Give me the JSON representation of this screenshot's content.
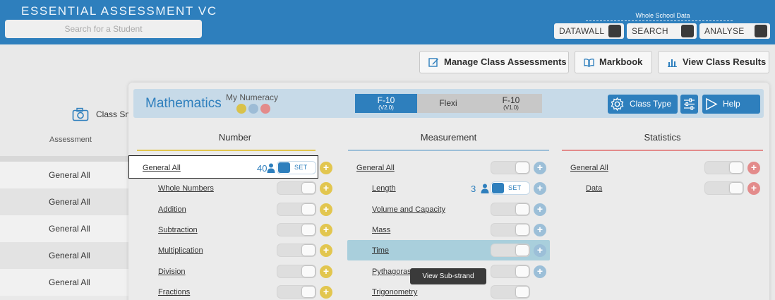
{
  "app": {
    "title": "ESSENTIAL ASSESSMENT VC"
  },
  "search": {
    "placeholder": "Search for a Student"
  },
  "whole_school": {
    "label": "Whole School Data",
    "buttons": [
      "DATAWALL",
      "SEARCH",
      "ANALYSE"
    ]
  },
  "actions": {
    "manage": "Manage Class Assessments",
    "markbook": "Markbook",
    "results": "View Class Results"
  },
  "background": {
    "class_label": "Class Sn",
    "assessment_header": "Assessment",
    "rows": [
      "General All",
      "General All",
      "General All",
      "General All",
      "General All"
    ]
  },
  "panel": {
    "subject": "Mathematics",
    "my_numeracy": "My Numeracy",
    "dot_colors": [
      "#d9c24a",
      "#9dbcd6",
      "#e38b8b"
    ],
    "curriculum_tabs": [
      {
        "main": "F-10",
        "sub": "(V2.0)",
        "active": true
      },
      {
        "main": "Flexi",
        "sub": "",
        "active": false
      },
      {
        "main": "F-10",
        "sub": "(V1.0)",
        "active": false
      }
    ],
    "class_type": "Class Type",
    "help": "Help",
    "set_label": "SET",
    "tooltip": "View Sub-strand",
    "columns": [
      {
        "title": "Number",
        "accent": "#e2c64f",
        "items": [
          {
            "label": "General All",
            "indent": false,
            "set": true,
            "count": "40"
          },
          {
            "label": "Whole Numbers",
            "indent": true,
            "set": false
          },
          {
            "label": "Addition",
            "indent": true,
            "set": false
          },
          {
            "label": "Subtraction",
            "indent": true,
            "set": false
          },
          {
            "label": "Multiplication",
            "indent": true,
            "set": false
          },
          {
            "label": "Division",
            "indent": true,
            "set": false
          },
          {
            "label": "Fractions",
            "indent": true,
            "set": false
          }
        ]
      },
      {
        "title": "Measurement",
        "accent": "#9cbfd8",
        "items": [
          {
            "label": "General All",
            "indent": false,
            "set": false
          },
          {
            "label": "Length",
            "indent": true,
            "set": true,
            "count": "3"
          },
          {
            "label": "Volume and Capacity",
            "indent": true,
            "set": false
          },
          {
            "label": "Mass",
            "indent": true,
            "set": false
          },
          {
            "label": "Time",
            "indent": true,
            "set": false,
            "highlighted": true
          },
          {
            "label": "Pythagoras",
            "indent": true,
            "set": false
          },
          {
            "label": "Trigonometry",
            "indent": true,
            "set": false
          }
        ]
      },
      {
        "title": "Statistics",
        "accent": "#e38b8b",
        "items": [
          {
            "label": "General All",
            "indent": false,
            "set": false
          },
          {
            "label": "Data",
            "indent": true,
            "set": false
          }
        ]
      }
    ]
  }
}
